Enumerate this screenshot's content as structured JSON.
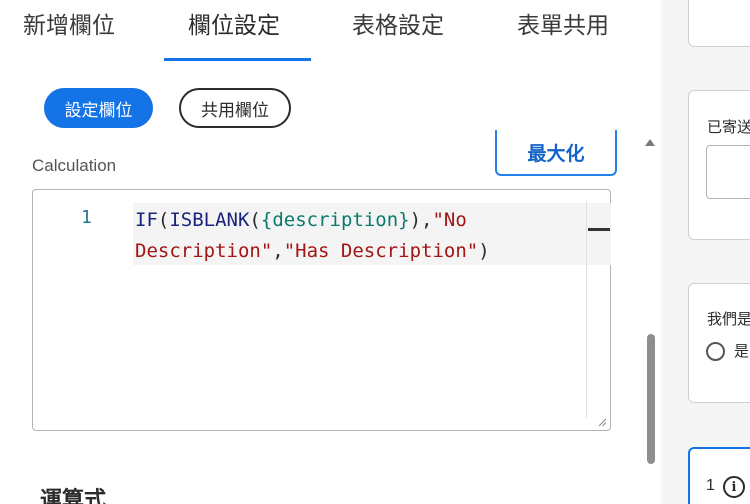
{
  "tabs": [
    {
      "label": "新增欄位",
      "active": false
    },
    {
      "label": "欄位設定",
      "active": true
    },
    {
      "label": "表格設定",
      "active": false
    },
    {
      "label": "表單共用",
      "active": false
    }
  ],
  "pills": {
    "primary": "設定欄位",
    "secondary": "共用欄位"
  },
  "maximize_label": "最大化",
  "calculation_label": "Calculation",
  "editor": {
    "line_number": "1",
    "code": {
      "fn1": "IF",
      "p1": "(",
      "fn2": "ISBLANK",
      "p2": "(",
      "field": "{description}",
      "p3": "),",
      "str1a": "\"No",
      "str1b": "Description\"",
      "p4": ",",
      "str2": "\"Has Description\"",
      "p5": ")"
    }
  },
  "section_title": "運算式",
  "right_panel": {
    "card2_label": "已寄送",
    "card3_label": "我們是",
    "radio_label": "是",
    "card4_number": "1",
    "info_glyph": "i"
  },
  "colors": {
    "accent": "#1473e6",
    "function": "#1a237e",
    "field": "#0a7a6d",
    "string": "#a31515"
  }
}
